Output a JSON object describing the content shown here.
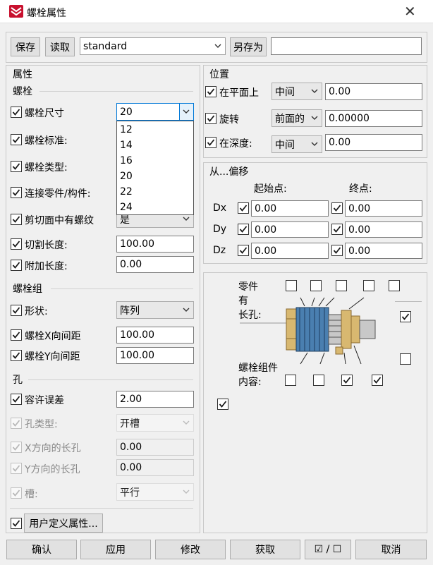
{
  "window": {
    "title": "螺栓属性",
    "close": "✕"
  },
  "toolbar": {
    "save": "保存",
    "load": "读取",
    "preset": "standard",
    "save_as": "另存为",
    "save_as_value": ""
  },
  "left": {
    "section": "属性",
    "bolt_group_title": "螺栓",
    "bolt_size": {
      "label": "螺栓尺寸",
      "value": "20",
      "options": [
        "12",
        "14",
        "16",
        "20",
        "22",
        "24"
      ]
    },
    "bolt_standard": {
      "label": "螺栓标准:"
    },
    "bolt_type": {
      "label": "螺栓类型:"
    },
    "connect_parts": {
      "label": "连接零件/构件:"
    },
    "thread_in_mat": {
      "label": "剪切面中有螺纹",
      "value": "是"
    },
    "cut_length": {
      "label": "切割长度:",
      "value": "100.00"
    },
    "extra_length": {
      "label": "附加长度:",
      "value": "0.00"
    },
    "group_title": "螺栓组",
    "shape": {
      "label": "形状:",
      "value": "阵列"
    },
    "spacing_x": {
      "label": "螺栓X向间距",
      "value": "100.00"
    },
    "spacing_y": {
      "label": "螺栓Y向间距",
      "value": "100.00"
    },
    "hole_title": "孔",
    "tolerance": {
      "label": "容许误差",
      "value": "2.00"
    },
    "hole_type": {
      "label": "孔类型:",
      "value": "开槽"
    },
    "slot_x": {
      "label": "X方向的长孔",
      "value": "0.00"
    },
    "slot_y": {
      "label": "Y方向的长孔",
      "value": "0.00"
    },
    "slot": {
      "label": "槽:",
      "value": "平行"
    },
    "user_attr": "用户定义属性..."
  },
  "right": {
    "position_title": "位置",
    "on_plane": {
      "label": "在平面上",
      "combo": "中间",
      "value": "0.00"
    },
    "rotation": {
      "label": "旋转",
      "combo": "前面的",
      "value": "0.00000"
    },
    "at_depth": {
      "label": "在深度:",
      "combo": "中间",
      "value": "0.00"
    },
    "offset_title": "从...偏移",
    "start_label": "起始点:",
    "end_label": "终点:",
    "offsets": [
      {
        "axis": "Dx",
        "start": "0.00",
        "end": "0.00"
      },
      {
        "axis": "Dy",
        "start": "0.00",
        "end": "0.00"
      },
      {
        "axis": "Dz",
        "start": "0.00",
        "end": "0.00"
      }
    ],
    "parts_label": "零件",
    "has_label": "有",
    "slot_label": "长孔:",
    "assembly_label": "螺栓组件",
    "content_label": "内容:"
  },
  "footer": {
    "ok": "确认",
    "apply": "应用",
    "modify": "修改",
    "get": "获取",
    "toggle": "☑ / ☐",
    "cancel": "取消"
  },
  "colors": {
    "check": "#1a1a1a",
    "bolt_blue": "#4a7fb0",
    "nut_tan": "#d8b870"
  }
}
